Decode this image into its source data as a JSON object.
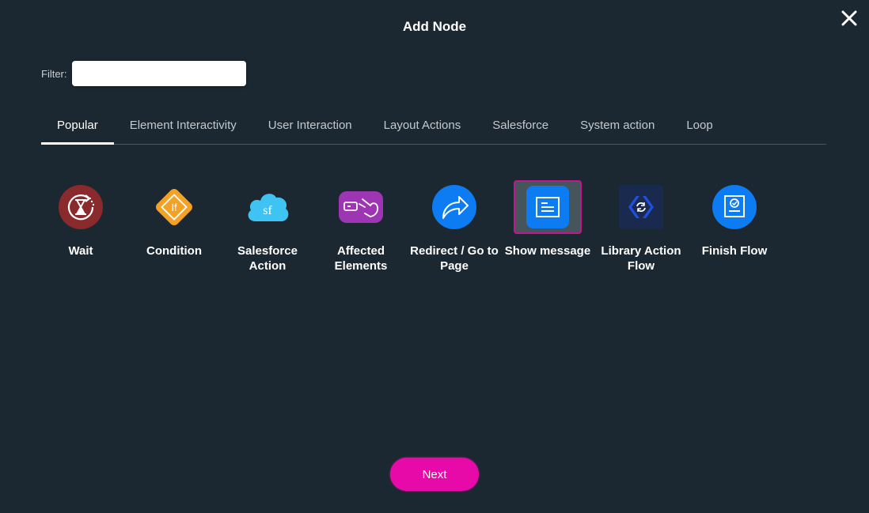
{
  "dialog": {
    "title": "Add Node",
    "close_icon": "close-icon"
  },
  "filter": {
    "label": "Filter:",
    "value": "",
    "placeholder": ""
  },
  "tabs": [
    {
      "label": "Popular",
      "active": true
    },
    {
      "label": "Element Interactivity",
      "active": false
    },
    {
      "label": "User Interaction",
      "active": false
    },
    {
      "label": "Layout Actions",
      "active": false
    },
    {
      "label": "Salesforce",
      "active": false
    },
    {
      "label": "System action",
      "active": false
    },
    {
      "label": "Loop",
      "active": false
    }
  ],
  "nodes": [
    {
      "label": "Wait",
      "icon": "hourglass-timer-icon",
      "color": "#8b2a2c",
      "selected": false
    },
    {
      "label": "Condition",
      "icon": "if-diamond-icon",
      "color": "#f4a226",
      "selected": false
    },
    {
      "label": "Salesforce Action",
      "icon": "salesforce-cloud-icon",
      "color": "#3fc3f3",
      "selected": false
    },
    {
      "label": "Affected Elements",
      "icon": "hand-pointer-element-icon",
      "color": "#9e35b3",
      "selected": false
    },
    {
      "label": "Redirect / Go to Page",
      "icon": "redirect-arrow-icon",
      "color": "#0d7cf2",
      "selected": false
    },
    {
      "label": "Show message",
      "icon": "message-box-icon",
      "color": "#0d7cf2",
      "selected": true
    },
    {
      "label": "Library Action Flow",
      "icon": "library-code-sync-icon",
      "color": "#1a2a4f",
      "selected": false
    },
    {
      "label": "Finish Flow",
      "icon": "finish-checkmark-icon",
      "color": "#0d7cf2",
      "selected": false
    }
  ],
  "footer": {
    "next_label": "Next"
  },
  "colors": {
    "background": "#1c2831",
    "accent": "#e70aa8",
    "selected_border": "#c2168e"
  }
}
